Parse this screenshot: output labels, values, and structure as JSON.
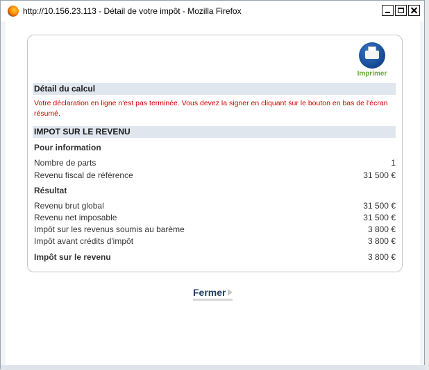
{
  "window": {
    "title": "http://10.156.23.113 - Détail de votre impôt - Mozilla Firefox"
  },
  "print": {
    "label": "Imprimer"
  },
  "detail": {
    "heading": "Détail du calcul",
    "warning": "Votre déclaration en ligne n'est pas terminée. Vous devez la signer en cliquant sur le bouton en bas de l'écran résumé."
  },
  "impot": {
    "heading": "IMPOT SUR LE REVENU",
    "info_heading": "Pour information",
    "info_rows": [
      {
        "label": "Nombre de parts",
        "value": "1"
      },
      {
        "label": "Revenu fiscal de référence",
        "value": "31 500 €"
      }
    ],
    "result_heading": "Résultat",
    "result_rows": [
      {
        "label": "Revenu brut global",
        "value": "31 500 €"
      },
      {
        "label": "Revenu net imposable",
        "value": "31 500 €"
      },
      {
        "label": "Impôt sur les revenus soumis au barème",
        "value": "3 800 €"
      },
      {
        "label": "Impôt avant crédits d'impôt",
        "value": "3 800 €"
      }
    ],
    "total": {
      "label": "Impôt sur le revenu",
      "value": "3 800 €"
    }
  },
  "actions": {
    "close_label": "Fermer"
  }
}
